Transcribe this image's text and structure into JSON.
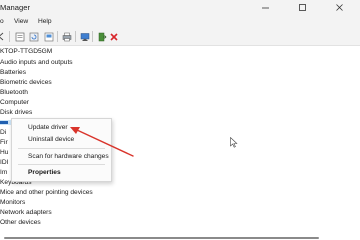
{
  "window": {
    "title": "Manager"
  },
  "menu": [
    "o",
    "View",
    "Help"
  ],
  "toolbar": [
    "back-icon",
    "forward-icon",
    "properties-icon",
    "help-icon",
    "print-icon",
    "computer-icon",
    "update-driver-icon",
    "uninstall-icon"
  ],
  "tree": {
    "root": "KTOP-TTGD5GM",
    "items": [
      "Audio inputs and outputs",
      "Batteries",
      "Biometric devices",
      "Bluetooth",
      "Computer",
      "Disk drives"
    ],
    "partial_items": [
      "Di",
      "Fir",
      "Hu",
      "IDI",
      "Im"
    ],
    "items_after": [
      "Keyboards",
      "Mice and other pointing devices",
      "Monitors",
      "Network adapters",
      "Other devices"
    ]
  },
  "context_menu": {
    "update_driver": "Update driver",
    "uninstall_device": "Uninstall device",
    "scan_hardware": "Scan for hardware changes",
    "properties": "Properties"
  },
  "colors": {
    "arrow": "#d9342b",
    "selection": "#cce4f7",
    "chrome": "#f3f3f3"
  }
}
